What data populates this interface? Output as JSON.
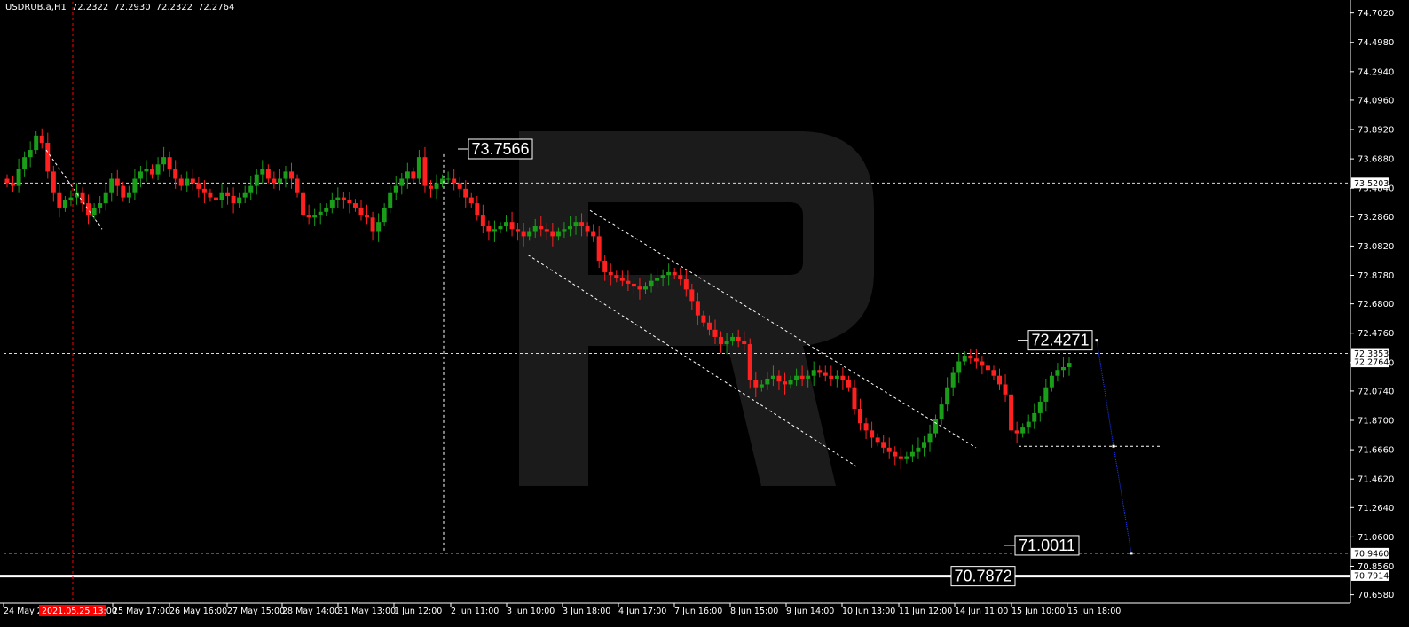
{
  "header": {
    "symbol": "USDRUB.a,H1",
    "open": "72.2322",
    "high": "72.2930",
    "low": "72.2322",
    "close": "72.2764"
  },
  "colors": {
    "background": "#000000",
    "bull": "#1a9e1a",
    "bear": "#ff2020",
    "axis": "#ffffff",
    "projection": "#1f3cff",
    "watermark": "#1c1c1c",
    "cursor_marker": "#ff0000"
  },
  "chart_data": {
    "type": "candlestick",
    "y_ticks": [
      "74.7020",
      "74.4980",
      "74.2940",
      "74.0960",
      "73.8920",
      "73.6880",
      "73.4840",
      "73.2860",
      "73.0820",
      "72.8780",
      "72.6800",
      "72.4760",
      "72.2720",
      "72.0740",
      "71.8700",
      "71.6660",
      "71.4620",
      "71.2640",
      "71.0600",
      "70.8560",
      "70.6580"
    ],
    "ylim": [
      70.6,
      74.78
    ],
    "x_labels": [
      "24 May 2",
      "25 May 17:00",
      "26 May 16:00",
      "27 May 15:00",
      "28 May 14:00",
      "31 May 13:00",
      "1 Jun 12:00",
      "2 Jun 11:00",
      "3 Jun 10:00",
      "3 Jun 18:00",
      "4 Jun 17:00",
      "7 Jun 16:00",
      "8 Jun 15:00",
      "9 Jun 14:00",
      "10 Jun 13:00",
      "11 Jun 12:00",
      "14 Jun 11:00",
      "15 Jun 10:00",
      "15 Jun 18:00"
    ],
    "cursor_time_label": "2021.05.25 13:00",
    "price_labels": [
      {
        "value": 73.5203,
        "text": "73.5203"
      },
      {
        "value": 72.3353,
        "text": "72.3353"
      },
      {
        "value": 72.2764,
        "text": "72.2764"
      },
      {
        "value": 70.946,
        "text": "70.9460"
      },
      {
        "value": 70.7914,
        "text": "70.7914"
      }
    ],
    "horizontal_levels": [
      73.5203,
      72.3353,
      70.946
    ],
    "annotations": [
      {
        "text": "73.7566",
        "value": 73.7566
      },
      {
        "text": "72.4271",
        "value": 72.4271
      },
      {
        "text": "71.0011",
        "value": 71.0011
      },
      {
        "text": "70.7872",
        "value": 70.7872
      }
    ],
    "closes": [
      73.52,
      73.5,
      73.62,
      73.7,
      73.75,
      73.85,
      73.8,
      73.6,
      73.45,
      73.35,
      73.4,
      73.42,
      73.45,
      73.38,
      73.3,
      73.35,
      73.38,
      73.45,
      73.55,
      73.5,
      73.42,
      73.45,
      73.55,
      73.6,
      73.62,
      73.58,
      73.65,
      73.7,
      73.62,
      73.55,
      73.5,
      73.55,
      73.52,
      73.48,
      73.45,
      73.42,
      73.4,
      73.45,
      73.43,
      73.38,
      73.42,
      73.45,
      73.5,
      73.58,
      73.62,
      73.55,
      73.52,
      73.55,
      73.6,
      73.55,
      73.45,
      73.3,
      73.28,
      73.3,
      73.32,
      73.35,
      73.4,
      73.42,
      73.4,
      73.38,
      73.35,
      73.3,
      73.28,
      73.18,
      73.25,
      73.35,
      73.45,
      73.5,
      73.55,
      73.6,
      73.55,
      73.7,
      73.5,
      73.48,
      73.52,
      73.55,
      73.55,
      73.52,
      73.48,
      73.42,
      73.38,
      73.3,
      73.22,
      73.18,
      73.2,
      73.22,
      73.25,
      73.2,
      73.18,
      73.15,
      73.18,
      73.22,
      73.2,
      73.18,
      73.15,
      73.18,
      73.2,
      73.22,
      73.25,
      73.22,
      73.18,
      73.15,
      72.98,
      72.9,
      72.88,
      72.86,
      72.84,
      72.82,
      72.8,
      72.78,
      72.8,
      72.84,
      72.86,
      72.88,
      72.9,
      72.88,
      72.85,
      72.78,
      72.7,
      72.6,
      72.55,
      72.5,
      72.45,
      72.4,
      72.42,
      72.45,
      72.42,
      72.4,
      72.15,
      72.1,
      72.12,
      72.16,
      72.18,
      72.14,
      72.12,
      72.15,
      72.18,
      72.16,
      72.18,
      72.22,
      72.2,
      72.18,
      72.16,
      72.18,
      72.15,
      72.1,
      71.95,
      71.85,
      71.8,
      71.75,
      71.72,
      71.68,
      71.65,
      71.62,
      71.6,
      71.62,
      71.65,
      71.68,
      71.72,
      71.78,
      71.88,
      71.98,
      72.1,
      72.2,
      72.28,
      72.32,
      72.3,
      72.28,
      72.25,
      72.22,
      72.18,
      72.12,
      72.05,
      71.8,
      71.78,
      71.82,
      71.86,
      71.92,
      72.0,
      72.1,
      72.18,
      72.22,
      72.24,
      72.27
    ],
    "projection_points": [
      {
        "label": "72.4271",
        "value": 72.4271
      },
      {
        "label": "71.69",
        "value": 71.69
      },
      {
        "label": "70.946",
        "value": 70.946
      }
    ]
  }
}
